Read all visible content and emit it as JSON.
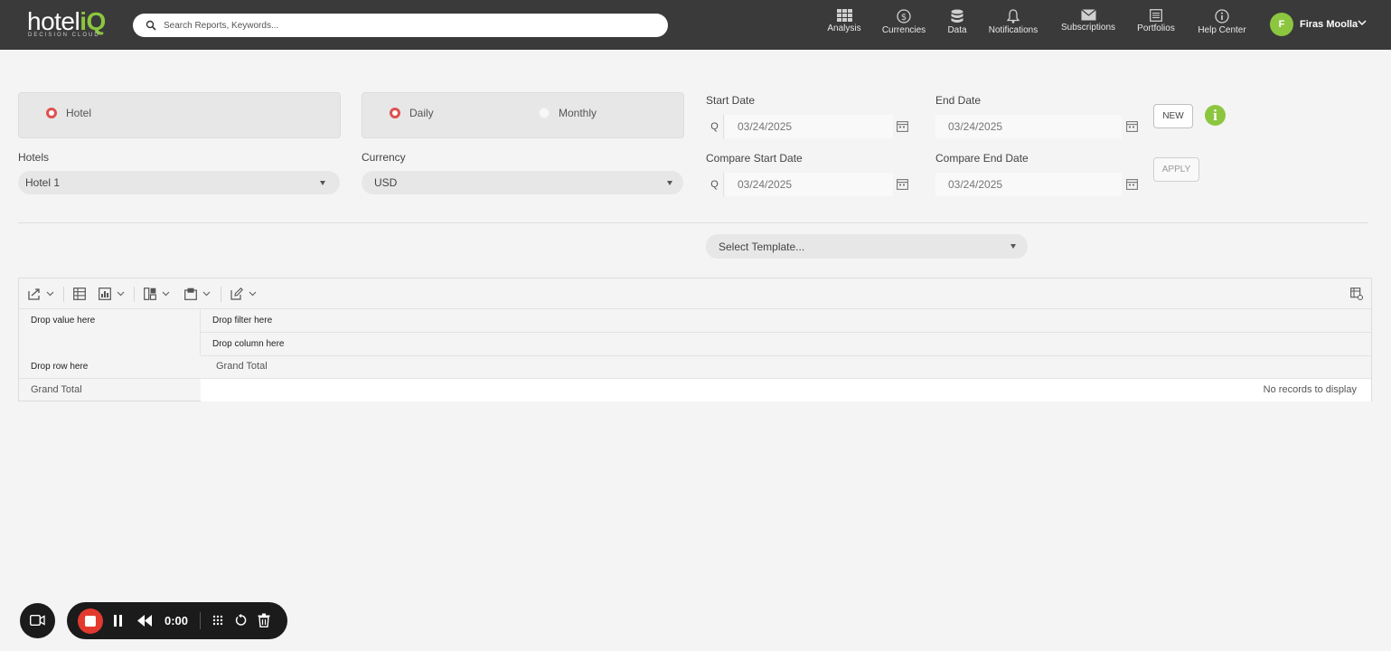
{
  "header": {
    "logo": {
      "word_main": "hotel",
      "word_accent": "iQ",
      "tagline": "DECISION CLOUD"
    },
    "search": {
      "placeholder": "Search Reports, Keywords...",
      "value": ""
    },
    "nav": [
      {
        "label": "Analysis",
        "icon": "grid-icon"
      },
      {
        "label": "Currencies",
        "icon": "dollar-circle-icon"
      },
      {
        "label": "Data",
        "icon": "database-icon"
      },
      {
        "label": "Notifications",
        "icon": "bell-icon"
      },
      {
        "label": "Subscriptions",
        "icon": "envelope-icon"
      },
      {
        "label": "Portfolios",
        "icon": "portfolio-icon"
      },
      {
        "label": "Help Center",
        "icon": "info-circle-icon"
      }
    ],
    "user": {
      "initial": "F",
      "name": "Firas Moolla"
    }
  },
  "filters": {
    "scope_radio": {
      "options": [
        {
          "label": "Hotel",
          "selected": true
        }
      ]
    },
    "period_radio": {
      "options": [
        {
          "label": "Daily",
          "selected": true
        },
        {
          "label": "Monthly",
          "selected": false
        }
      ]
    },
    "hotels": {
      "label": "Hotels",
      "value": "Hotel 1"
    },
    "currency": {
      "label": "Currency",
      "value": "USD"
    },
    "start_date": {
      "label": "Start Date",
      "prefix": "Q",
      "placeholder": "03/24/2025"
    },
    "end_date": {
      "label": "End Date",
      "placeholder": "03/24/2025"
    },
    "compare_start_date": {
      "label": "Compare Start Date",
      "prefix": "Q",
      "placeholder": "03/24/2025"
    },
    "compare_end_date": {
      "label": "Compare End Date",
      "placeholder": "03/24/2025"
    },
    "new_button": "NEW",
    "apply_button": "APPLY",
    "info_glyph": "i",
    "template": {
      "value": "Select Template..."
    }
  },
  "pivot": {
    "drop_value": "Drop value here",
    "drop_filter": "Drop filter here",
    "drop_column": "Drop column here",
    "drop_row": "Drop row here",
    "grand_total_col": "Grand Total",
    "grand_total_row": "Grand Total",
    "empty_message": "No records to display"
  },
  "recorder": {
    "time": "0:00"
  },
  "colors": {
    "topbar": "#3a3a3a",
    "accent_green": "#8cc63f",
    "radio_red": "#e05050",
    "record_red": "#e33a2f"
  }
}
